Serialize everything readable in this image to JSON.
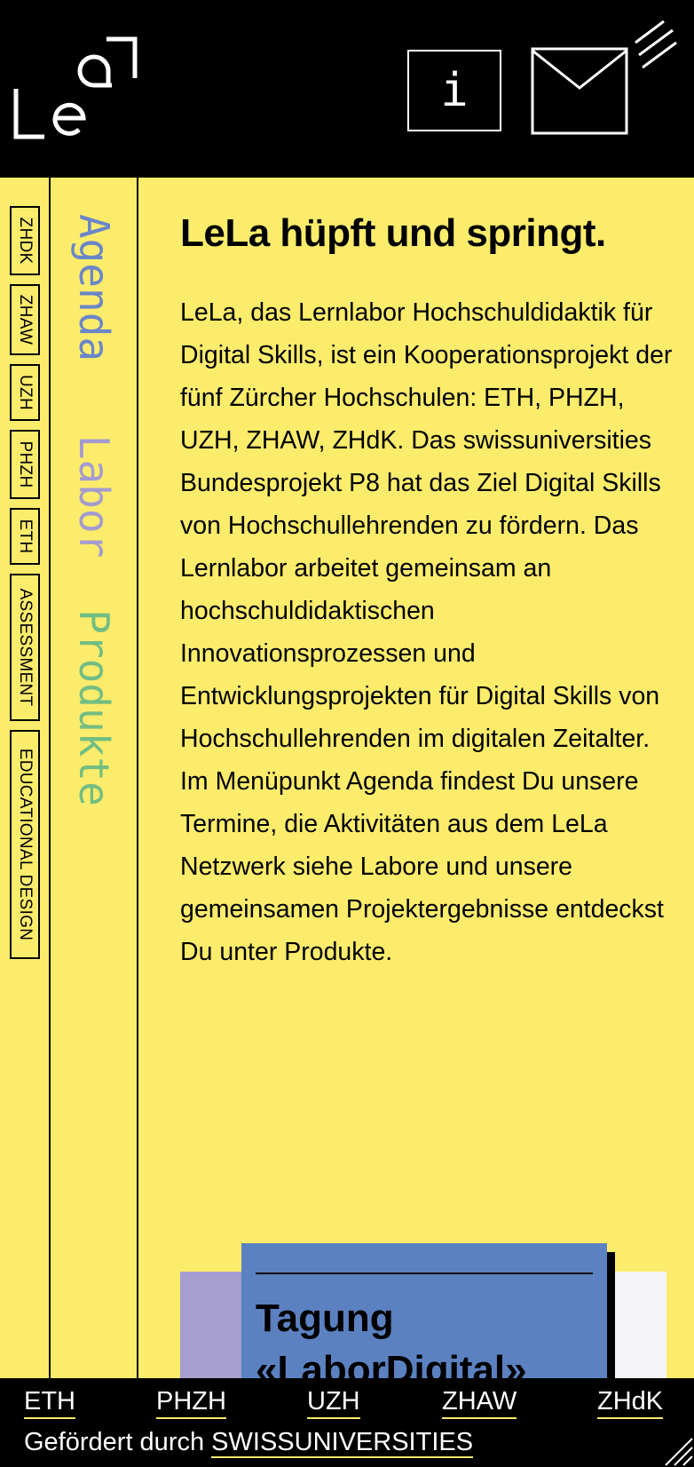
{
  "colors": {
    "background": "#fcec6b",
    "header": "#000000",
    "agenda": "#6b86c8",
    "labor": "#a39bd0",
    "produkte": "#72bd83",
    "card_primary": "#5b81c1",
    "card_left": "#a59ecf",
    "card_right": "#f5f5f8",
    "underline": "#fcec6b"
  },
  "header": {
    "logo_icon": "lela-logo",
    "info_label": "i",
    "info_icon": "info-icon",
    "mail_icon": "mail-icon"
  },
  "tags": [
    "ZHDK",
    "ZHAW",
    "UZH",
    "PHZH",
    "ETH",
    "ASSESSMENT",
    "EDUCATIONAL DESIGN"
  ],
  "nav": {
    "agenda": "Agenda",
    "labor": "Labor",
    "produkte": "Produkte"
  },
  "main": {
    "title": "LeLa hüpft und springt.",
    "body": "LeLa, das Lernlabor Hochschuldidaktik für Digital Skills, ist ein Kooperationsprojekt der fünf Zürcher Hochschulen: ETH, PHZH, UZH, ZHAW, ZHdK. Das swissuniversities Bundesprojekt P8 hat das Ziel Digital Skills von Hochschullehrenden zu fördern. Das Lernlabor arbeitet gemeinsam an hochschuldidaktischen Innovationsprozessen und Entwicklungsprojekten für Digital Skills von Hochschullehrenden im digitalen Zeitalter.\nIm Menüpunkt Agenda findest Du unsere Termine, die Aktivitäten aus dem LeLa Netzwerk siehe Labore und unsere gemeinsamen Projektergebnisse entdeckst Du unter Produkte."
  },
  "card": {
    "title": "Tagung «LaborDigital»"
  },
  "footer": {
    "links": [
      "ETH",
      "PHZH",
      "UZH",
      "ZHAW",
      "ZHdK"
    ],
    "funded_prefix": "Gefördert durch",
    "funded_link": "SWISSUNIVERSITIES"
  }
}
